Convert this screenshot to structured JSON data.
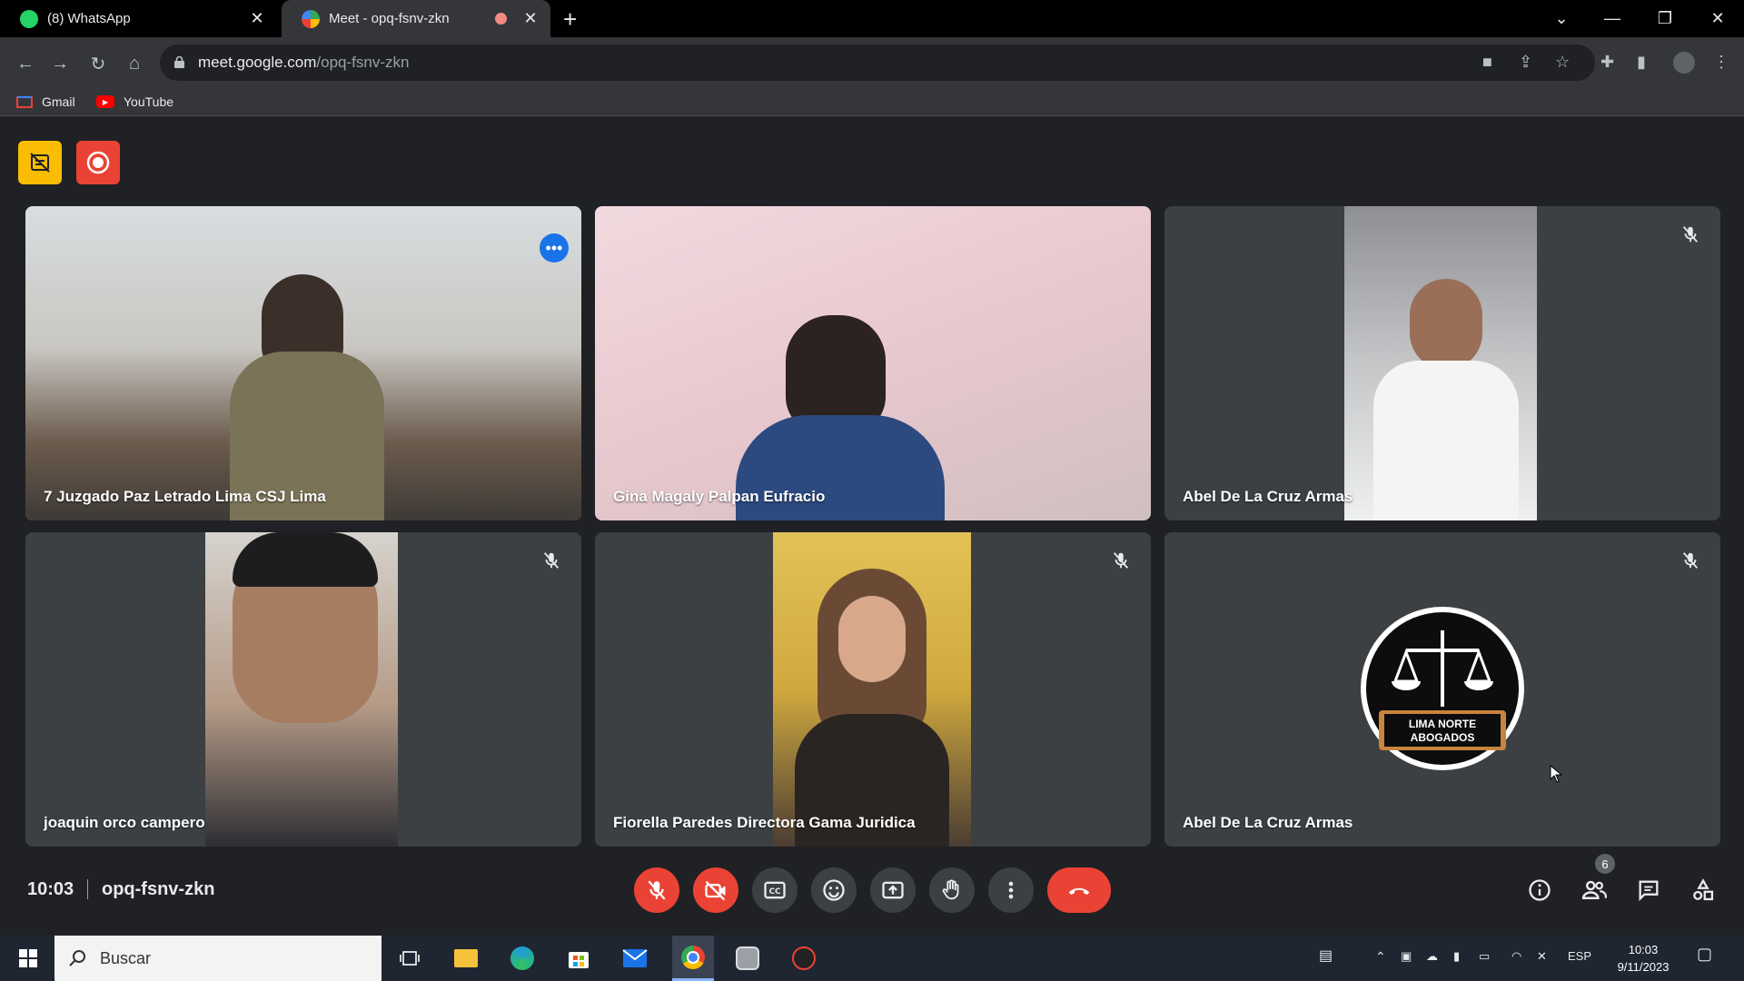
{
  "browser": {
    "tabs": [
      {
        "title": "(8) WhatsApp",
        "active": false
      },
      {
        "title": "Meet - opq-fsnv-zkn",
        "active": true
      }
    ],
    "url_host": "meet.google.com",
    "url_path": "/opq-fsnv-zkn",
    "bookmarks": [
      {
        "label": "Gmail"
      },
      {
        "label": "YouTube"
      }
    ]
  },
  "meet": {
    "participants": [
      {
        "name": "7 Juzgado Paz Letrado Lima CSJ Lima",
        "muted": false,
        "speaking": true
      },
      {
        "name": "Gina Magaly Palpan Eufracio",
        "muted": false,
        "speaking": false
      },
      {
        "name": "Abel De La Cruz Armas",
        "muted": true,
        "speaking": false
      },
      {
        "name": "joaquin orco campero",
        "muted": true,
        "speaking": false
      },
      {
        "name": "Fiorella Paredes Directora Gama Juridica",
        "muted": true,
        "speaking": false
      },
      {
        "name": "Abel De La Cruz Armas",
        "muted": true,
        "speaking": false
      }
    ],
    "logo": {
      "line1": "LIMA NORTE",
      "line2": "ABOGADOS"
    },
    "time": "10:03",
    "meeting_code": "opq-fsnv-zkn",
    "people_count": "6",
    "colors": {
      "accent": "#8ab4f8",
      "danger": "#ea4335",
      "tile_bg": "#3c4043",
      "page_bg": "#202124"
    }
  },
  "taskbar": {
    "search_placeholder": "Buscar",
    "language": "ESP",
    "time": "10:03",
    "date": "9/11/2023"
  }
}
